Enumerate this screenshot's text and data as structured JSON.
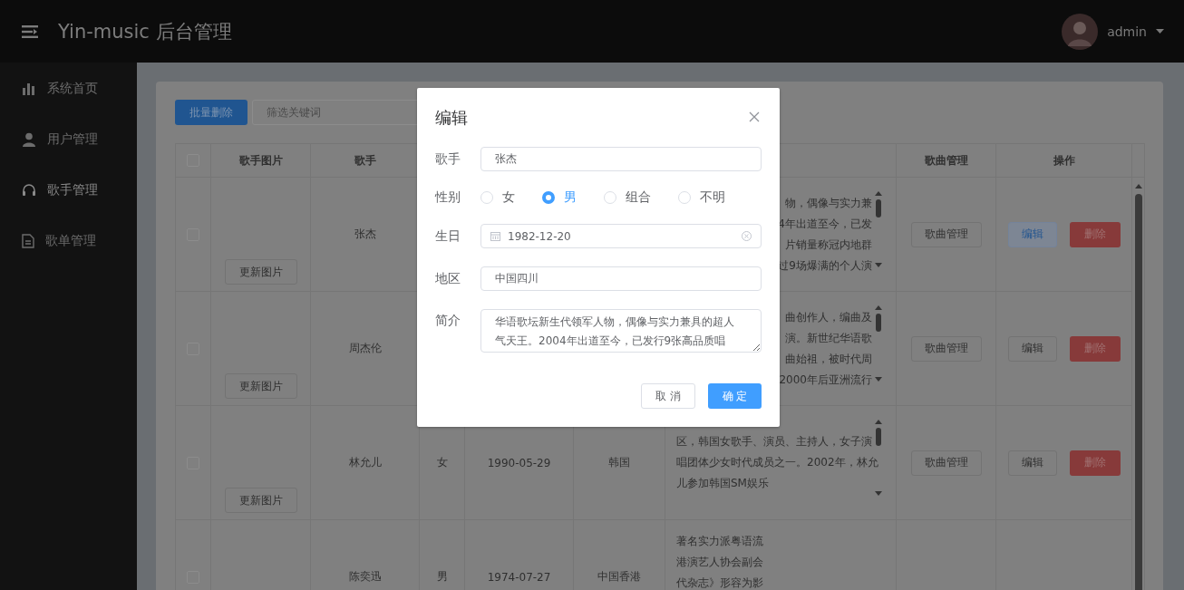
{
  "header": {
    "title": "Yin-music 后台管理",
    "user": "admin"
  },
  "sidebar": {
    "items": [
      {
        "kind": "chart",
        "label": "系统首页",
        "selected": false
      },
      {
        "kind": "user",
        "label": "用户管理",
        "selected": false
      },
      {
        "kind": "headphones",
        "label": "歌手管理",
        "selected": true
      },
      {
        "kind": "file",
        "label": "歌单管理",
        "selected": false
      }
    ]
  },
  "toolbar": {
    "delete_button": "批量删除",
    "search": {
      "placeholder": "筛选关键词"
    }
  },
  "table": {
    "columns": [
      {
        "kind": "select",
        "checked": false
      },
      {
        "kind": "text",
        "label": "歌手图片"
      },
      {
        "kind": "text",
        "label": "歌手"
      },
      {
        "kind": "covered"
      },
      {
        "kind": "covered"
      },
      {
        "kind": "covered"
      },
      {
        "kind": "covered"
      },
      {
        "kind": "text",
        "label": "歌曲管理"
      },
      {
        "kind": "text",
        "label": "操作"
      }
    ],
    "rows": [
      {
        "checked": false,
        "photo_button": "更新图片",
        "singer": "张杰",
        "intro": [
          "物，偶像与实力兼",
          "4年出道至今，已发",
          "片销量称冠内地群",
          "过9场爆满的个人演"
        ],
        "intro_covered": true,
        "songs_button": "歌曲管理",
        "edit_button": "编辑",
        "edit_focused": true,
        "delete_button": "删除"
      },
      {
        "checked": false,
        "photo_button": "更新图片",
        "singer": "周杰伦",
        "intro": [
          "曲创作人，编曲及",
          "演。新世纪华语歌",
          "曲始祖，被时代周",
          "2000年后亚洲流行"
        ],
        "intro_covered": true,
        "songs_button": "歌曲管理",
        "edit_button": "编辑",
        "edit_focused": false,
        "delete_button": "删除"
      },
      {
        "checked": false,
        "photo_button": "更新图片",
        "singer": "林允儿",
        "gender": "女",
        "birth": "1990-05-29",
        "region": "韩国",
        "intro": [
          "区，韩国女歌手、演员、主持人，女子演",
          "唱团体少女时代成员之一。2002年，林允",
          "儿参加韩国SM娱乐"
        ],
        "intro_covered": false,
        "songs_button": "歌曲管理",
        "edit_button": "编辑",
        "edit_focused": false,
        "delete_button": "删除"
      },
      {
        "checked": false,
        "singer": "陈奕迅",
        "gender": "男",
        "birth": "1974-07-27",
        "region": "中国香港",
        "intro": [
          "著名实力派粤语流",
          "港演艺人协会副会",
          "代杂志》形容为影"
        ],
        "intro_covered": false
      }
    ]
  },
  "dialog": {
    "title": "编辑",
    "singer": {
      "label": "歌手",
      "value": "张杰"
    },
    "gender": {
      "label": "性别",
      "options": [
        {
          "label": "女",
          "selected": false
        },
        {
          "label": "男",
          "selected": true
        },
        {
          "label": "组合",
          "selected": false
        },
        {
          "label": "不明",
          "selected": false
        }
      ]
    },
    "birthday": {
      "label": "生日",
      "value": "1982-12-20"
    },
    "region": {
      "label": "地区",
      "value": "中国四川"
    },
    "intro": {
      "label": "简介",
      "value": "华语歌坛新生代领军人物，偶像与实力兼具的超人气天王。2004年出道至今，已发行9张高品质唱"
    },
    "cancel_button": "取 消",
    "confirm_button": "确 定"
  }
}
